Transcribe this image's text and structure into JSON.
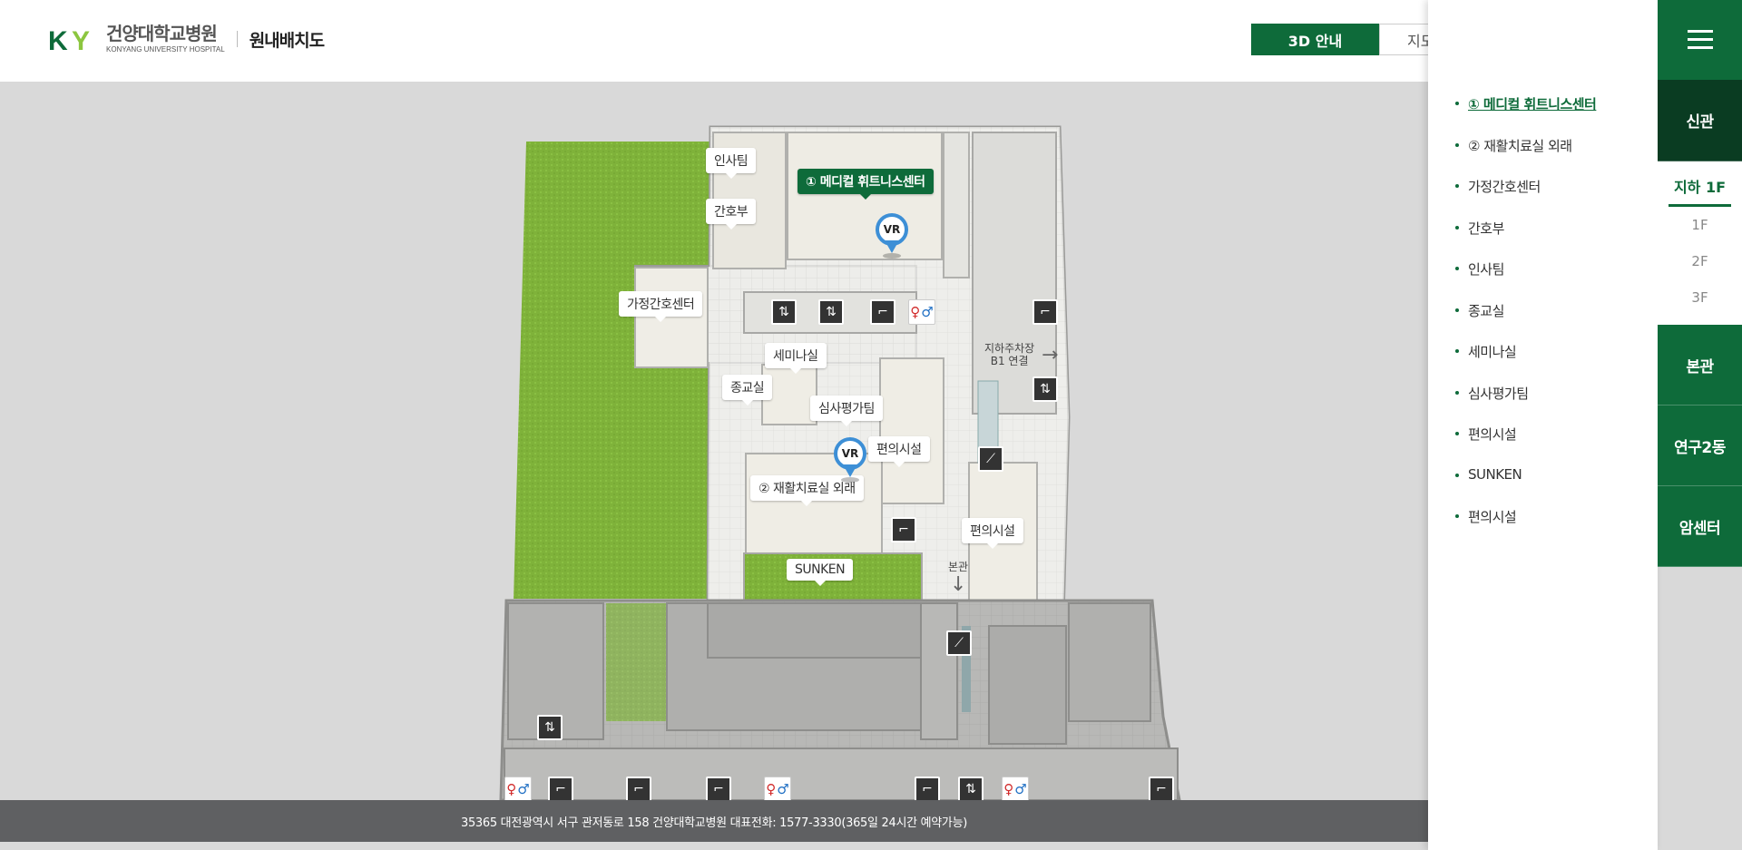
{
  "header": {
    "logo_ko": "건양대학교병원",
    "logo_en": "KONYANG UNIVERSITY HOSPITAL",
    "logo_mark": "KY",
    "page_title": "원내배치도",
    "tabs": [
      {
        "label": "3D 안내",
        "active": true
      },
      {
        "label": "지도",
        "active": false
      }
    ]
  },
  "map": {
    "labels": {
      "insa": "인사팀",
      "medical_fitness": "① 메디컬 휘트니스센터",
      "ganhobu": "간호부",
      "home_nursing": "가정간호센터",
      "seminar": "세미나실",
      "religion": "종교실",
      "review": "심사평가팀",
      "convenience1": "편의시설",
      "rehab": "② 재활치료실 외래",
      "convenience2": "편의시설",
      "sunken": "SUNKEN"
    },
    "parking_text": "지하주차장\nB1 연결",
    "main_building_text": "본관",
    "vr_label": "VR"
  },
  "footer": {
    "text": "35365 대전광역시 서구 관저동로 158 건양대학교병원  대표전화: 1577-3330(365일 24시간 예약가능)"
  },
  "poi_list": [
    {
      "label": "① 메디컬 휘트니스센터",
      "active": true
    },
    {
      "label": "② 재활치료실 외래",
      "active": false
    },
    {
      "label": "가정간호센터",
      "active": false
    },
    {
      "label": "간호부",
      "active": false
    },
    {
      "label": "인사팀",
      "active": false
    },
    {
      "label": "종교실",
      "active": false
    },
    {
      "label": "세미나실",
      "active": false
    },
    {
      "label": "심사평가팀",
      "active": false
    },
    {
      "label": "편의시설",
      "active": false
    },
    {
      "label": "SUNKEN",
      "active": false
    },
    {
      "label": "편의시설",
      "active": false
    }
  ],
  "nav": {
    "menu_icon": "hamburger-icon",
    "current_building": "신관",
    "floors": [
      {
        "label": "지하 1F",
        "active": true
      },
      {
        "label": "1F",
        "active": false
      },
      {
        "label": "2F",
        "active": false
      },
      {
        "label": "3F",
        "active": false
      }
    ],
    "other_buildings": [
      "본관",
      "연구2동",
      "암센터"
    ]
  },
  "colors": {
    "brand_green": "#0e6b3a",
    "brand_dark": "#0a3c22",
    "lime": "#8cc63f",
    "footer_gray": "#5f6062",
    "vr_blue": "#3d8fd6"
  }
}
